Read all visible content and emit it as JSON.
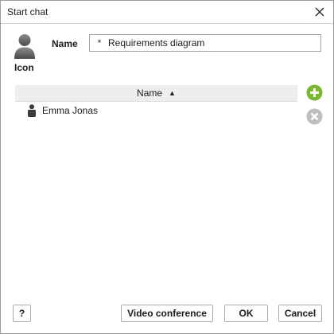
{
  "window": {
    "title": "Start chat"
  },
  "form": {
    "icon_label": "Icon",
    "name_label": "Name",
    "name_value": "Requirements diagram",
    "required_marker": "*"
  },
  "participants": {
    "column_header": "Name",
    "sort_indicator": "▲",
    "rows": [
      {
        "name": "Emma Jonas"
      }
    ]
  },
  "actions": {
    "add_icon": "plus-circle-icon",
    "remove_icon": "x-circle-icon",
    "add_color": "#7cb82f",
    "remove_color": "#bfbfbf"
  },
  "buttons": {
    "help": "?",
    "video_conference": "Video conference",
    "ok": "OK",
    "cancel": "Cancel"
  }
}
